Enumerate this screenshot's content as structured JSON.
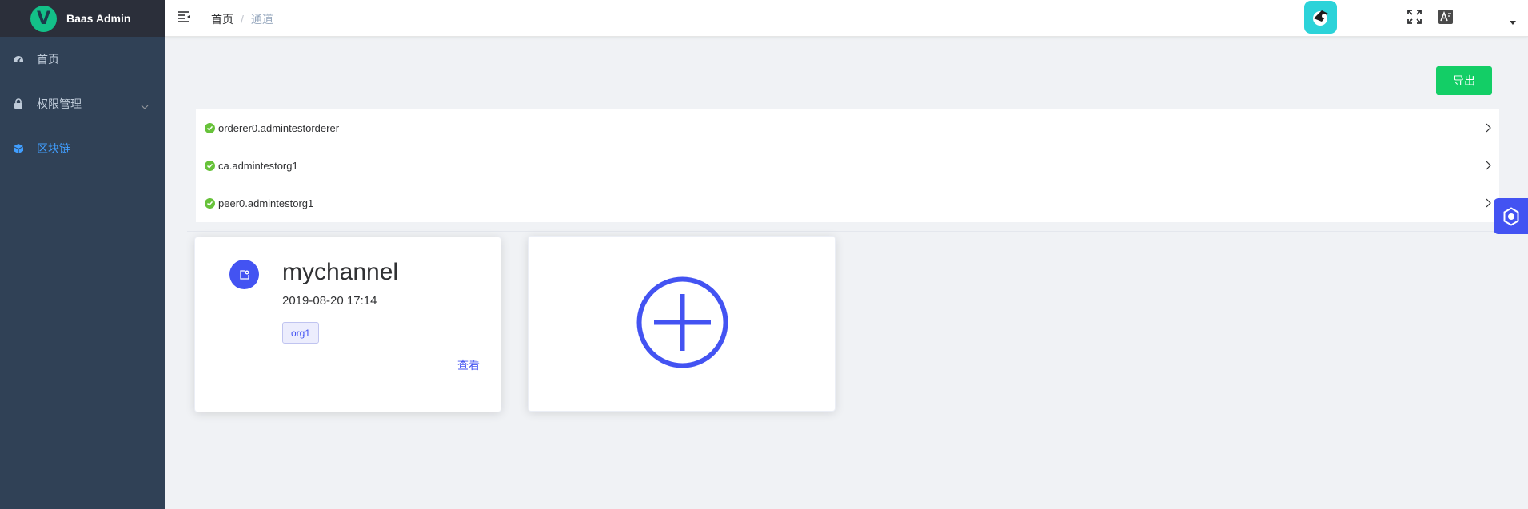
{
  "app": {
    "title": "Baas Admin",
    "logo_letter": "V",
    "brand_color": "#13c088"
  },
  "sidebar": {
    "items": [
      {
        "label": "首页",
        "icon": "dashboard-icon",
        "active": false
      },
      {
        "label": "权限管理",
        "icon": "lock-icon",
        "active": false,
        "expandable": true
      },
      {
        "label": "区块链",
        "icon": "cube-icon",
        "active": true
      }
    ]
  },
  "header": {
    "breadcrumb": {
      "home": "首页",
      "separator": "/",
      "current": "通道"
    },
    "actions": [
      "fullscreen-icon",
      "language-icon",
      "avatar",
      "caret-down-icon"
    ]
  },
  "toolbar": {
    "export_label": "导出",
    "export_color": "#13ce66"
  },
  "nodes": [
    {
      "name": "orderer0.admintestorderer",
      "status": "ok"
    },
    {
      "name": "ca.admintestorg1",
      "status": "ok"
    },
    {
      "name": "peer0.admintestorg1",
      "status": "ok"
    }
  ],
  "channels": [
    {
      "name": "mychannel",
      "date": "2019-08-20 17:14",
      "tags": [
        "org1"
      ],
      "view_label": "查看"
    }
  ],
  "add_channel": {
    "icon": "plus-circle-icon"
  },
  "colors": {
    "accent": "#4353f2",
    "sidebar_bg": "#304156",
    "active_menu": "#409eff",
    "status_ok": "#67c23a"
  }
}
